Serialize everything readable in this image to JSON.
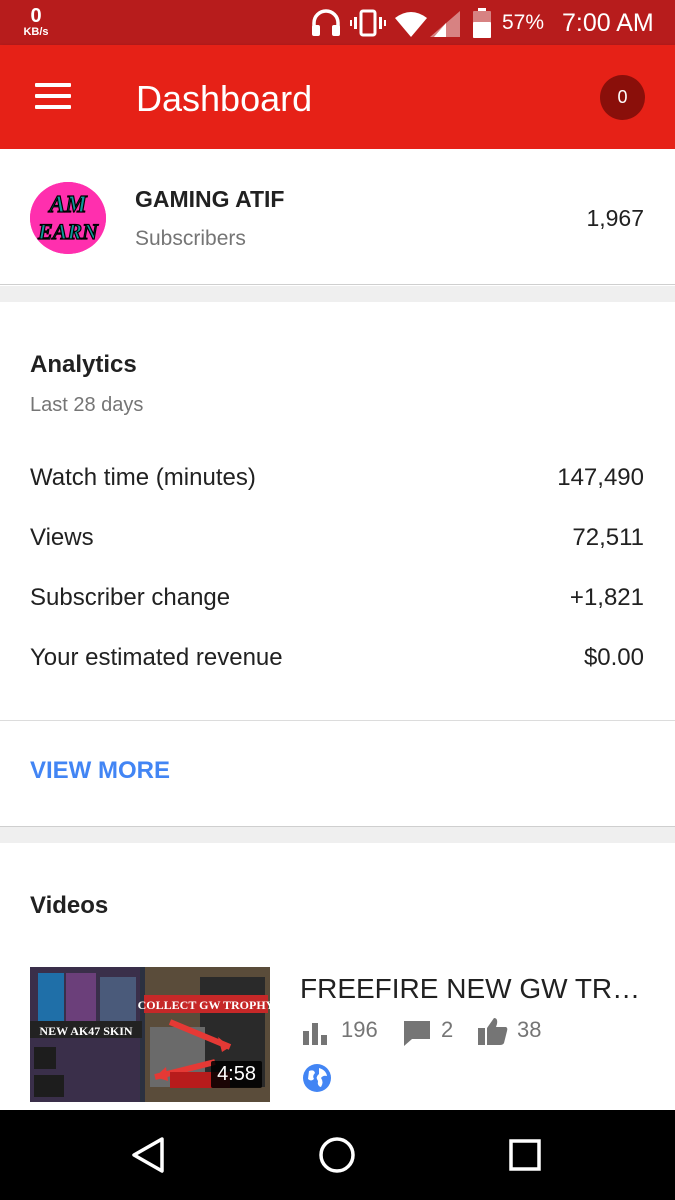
{
  "status_bar": {
    "net_speed_value": "0",
    "net_speed_unit": "KB/s",
    "battery_percent": "57%",
    "time": "7:00 AM",
    "icons": [
      "headset-icon",
      "vibrate-icon",
      "wifi-icon",
      "cell-signal-icon",
      "battery-icon"
    ]
  },
  "app_bar": {
    "title": "Dashboard",
    "notification_count": "0",
    "color": "#e62117"
  },
  "channel": {
    "avatar_text_line1": "AM",
    "avatar_text_line2": "EARN",
    "name": "GAMING ATIF",
    "subscribers_label": "Subscribers",
    "subscribers_count": "1,967"
  },
  "analytics": {
    "heading": "Analytics",
    "period": "Last 28 days",
    "rows": [
      {
        "label": "Watch time (minutes)",
        "value": "147,490"
      },
      {
        "label": "Views",
        "value": "72,511"
      },
      {
        "label": "Subscriber change",
        "value": "+1,821"
      },
      {
        "label": "Your estimated revenue",
        "value": "$0.00"
      }
    ],
    "view_more": "VIEW MORE",
    "link_color": "#4285f4"
  },
  "videos": {
    "heading": "Videos",
    "items": [
      {
        "title": "FREEFIRE NEW GW TROPHY",
        "duration": "4:58",
        "views": "196",
        "comments": "2",
        "likes": "38",
        "visibility": "public",
        "thumb_caption_1": "COLLECT GW TROPHY",
        "thumb_caption_2": "NEW AK47 SKIN"
      }
    ]
  },
  "nav_bar": {
    "buttons": [
      "back-icon",
      "home-icon",
      "recents-icon"
    ]
  }
}
